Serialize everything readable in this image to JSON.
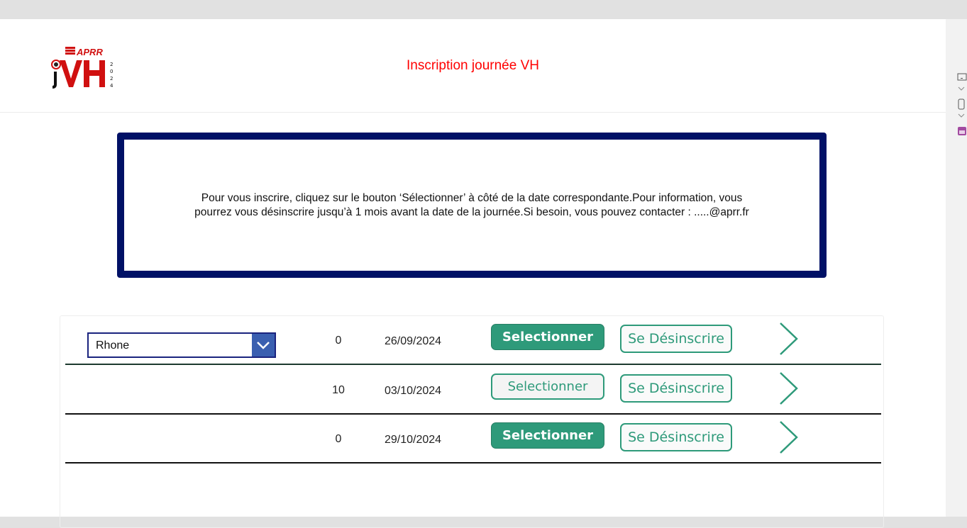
{
  "header": {
    "title": "Inscription journée VH",
    "logo_text": "APRR jVH 2024"
  },
  "info": {
    "text": "Pour vous inscrire, cliquez sur le bouton ‘Sélectionner’ à côté de la date correspondante.Pour information, vous pourrez vous désinscrire jusqu’à 1 mois avant la date de la journée.Si besoin, vous pouvez contacter : .....@aprr.fr"
  },
  "filter": {
    "selected": "Rhone"
  },
  "rows": [
    {
      "count": "0",
      "date": "26/09/2024",
      "select_label": "Selectionner",
      "unsubscribe_label": "Se Désinscrire",
      "select_state": "active"
    },
    {
      "count": "10",
      "date": "03/10/2024",
      "select_label": "Selectionner",
      "unsubscribe_label": "Se Désinscrire",
      "select_state": "inactive"
    },
    {
      "count": "0",
      "date": "29/10/2024",
      "select_label": "Selectionner",
      "unsubscribe_label": "Se Désinscrire",
      "select_state": "active"
    }
  ],
  "colors": {
    "accent": "#2e9a7a",
    "title": "#ff0000",
    "box_border": "#001166",
    "dropdown_button": "#3a5fb0"
  }
}
